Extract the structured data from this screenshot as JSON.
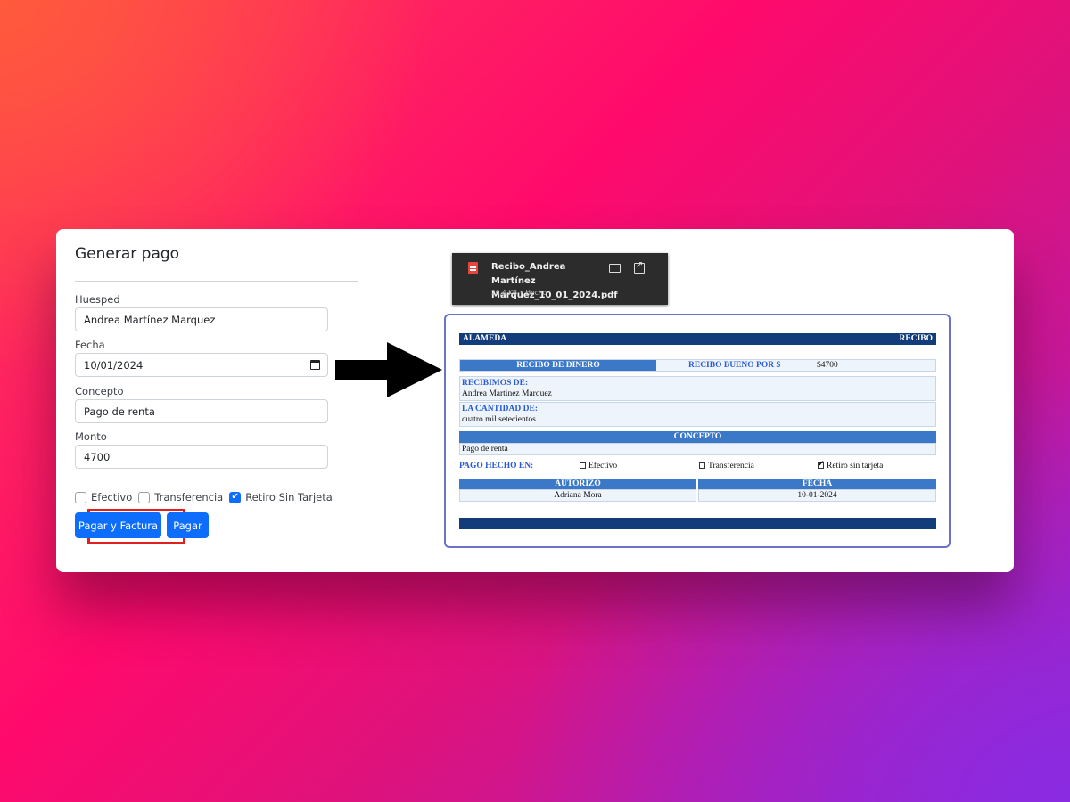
{
  "form": {
    "title": "Generar pago",
    "huesped_label": "Huesped",
    "huesped_value": "Andrea Martínez Marquez",
    "fecha_label": "Fecha",
    "fecha_value": "10/01/2024",
    "concepto_label": "Concepto",
    "concepto_value": "Pago de renta",
    "monto_label": "Monto",
    "monto_value": "4700",
    "checks": [
      {
        "label": "Efectivo",
        "checked": false
      },
      {
        "label": "Transferencia",
        "checked": false
      },
      {
        "label": "Retiro Sin Tarjeta",
        "checked": true
      }
    ],
    "btn_pagar_factura": "Pagar y Factura",
    "btn_pagar": "Pagar"
  },
  "download": {
    "filename": "Recibo_Andrea Martínez Marquez_10_01_2024.pdf",
    "meta": "20,4 KB • Hecho"
  },
  "receipt": {
    "brand": "ALAMEDA",
    "header_right": "RECIBO",
    "recibo_de_dinero": "RECIBO DE DINERO",
    "recibo_bueno_por": "RECIBO BUENO POR $",
    "amount": "$4700",
    "recibimos_label": "RECIBIMOS DE:",
    "recibimos_value": "Andrea Martinez Marquez",
    "cantidad_label": "LA CANTIDAD DE:",
    "cantidad_value": "cuatro mil setecientos",
    "concepto_header": "CONCEPTO",
    "concepto_value": "Pago de renta",
    "pago_hecho_label": "PAGO HECHO EN:",
    "options": [
      {
        "label": "Efectivo",
        "checked": false
      },
      {
        "label": "Transferencia",
        "checked": false
      },
      {
        "label": "Retiro sin tarjeta",
        "checked": true
      }
    ],
    "autorizo_header": "AUTORIZO",
    "fecha_header": "FECHA",
    "autorizo_value": "Adriana Mora",
    "fecha_value": "10-01-2024"
  },
  "colors": {
    "primary_button": "#0d6efd",
    "highlight_border": "#e0201f",
    "receipt_dark_blue": "#123c7a",
    "receipt_mid_blue": "#3b78c8"
  }
}
